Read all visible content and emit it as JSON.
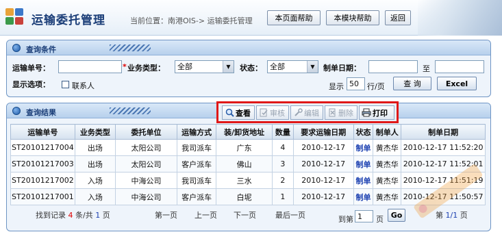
{
  "header": {
    "title": "运输委托管理",
    "breadcrumb": "当前位置：南港OIS-> 运输委托管理",
    "help_page_label": "本页面帮助",
    "help_module_label": "本模块帮助",
    "back_label": "返回"
  },
  "query": {
    "title": "查询条件",
    "waybill_label": "运输单号：",
    "waybill_value": "",
    "business_type_label": "业务类型：",
    "business_type_value": "全部",
    "status_label": "状态：",
    "status_value": "全部",
    "date_label": "制单日期：",
    "date_from": "",
    "date_to_label": "至",
    "date_to": "",
    "display_options_label": "显示选项：",
    "contact_checkbox_label": "联系人",
    "show_label": "显示",
    "page_size": "50",
    "per_page_label": "行/页",
    "search_button": "查 询",
    "excel_button": "Excel"
  },
  "results": {
    "title": "查询结果",
    "toolbar": {
      "view": "查看",
      "audit": "审核",
      "edit": "编辑",
      "delete": "删除",
      "print": "打印"
    },
    "columns": [
      "运输单号",
      "业务类型",
      "委托单位",
      "运输方式",
      "装/卸货地址",
      "数量",
      "要求运输日期",
      "状态",
      "制单人",
      "制单日期"
    ],
    "rows": [
      [
        "ST20101217004",
        "出场",
        "太阳公司",
        "我司派车",
        "广东",
        "4",
        "2010-12-17",
        "制单",
        "黄杰华",
        "2010-12-17 11:52:20"
      ],
      [
        "ST20101217003",
        "出场",
        "太阳公司",
        "客户派车",
        "佛山",
        "3",
        "2010-12-17",
        "制单",
        "黄杰华",
        "2010-12-17 11:52:01"
      ],
      [
        "ST20101217002",
        "入场",
        "中海公司",
        "我司派车",
        "三水",
        "2",
        "2010-12-17",
        "制单",
        "黄杰华",
        "2010-12-17 11:51:19"
      ],
      [
        "ST20101217001",
        "入场",
        "中海公司",
        "客户派车",
        "白坭",
        "1",
        "2010-12-17",
        "制单",
        "黄杰华",
        "2010-12-17 11:50:57"
      ]
    ]
  },
  "pager": {
    "found_prefix": "找到记录",
    "record_count": "4",
    "records_suffix": "条/共",
    "page_total": "1",
    "page_word": "页",
    "first": "第一页",
    "prev": "上一页",
    "next": "下一页",
    "last": "最后一页",
    "goto_prefix": "到第",
    "goto_value": "1",
    "goto_suffix": "页",
    "go_button": "Go",
    "current_prefix": "第",
    "current_page": "1/1",
    "current_suffix": "页"
  },
  "colors": {
    "title_blue": "#1b3e78",
    "highlight_red": "#e01818",
    "link_blue": "#1a3fb0"
  }
}
